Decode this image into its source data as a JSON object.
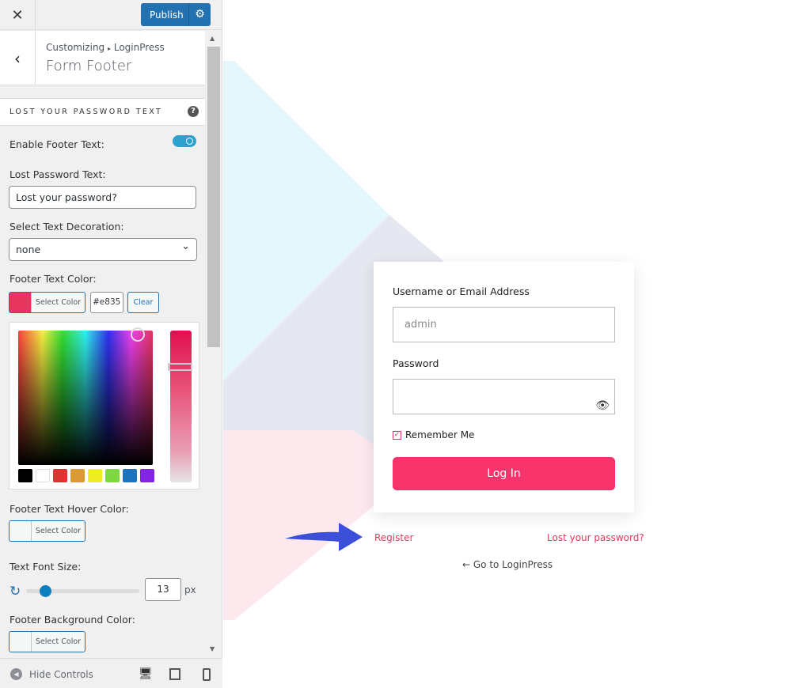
{
  "header": {
    "close_icon": "close-icon",
    "publish_label": "Publish",
    "settings_icon": "gear-icon"
  },
  "panel": {
    "breadcrumb_root": "Customizing",
    "breadcrumb_sep": "▸",
    "breadcrumb_section": "LoginPress",
    "title": "Form Footer",
    "section_title": "LOST YOUR PASSWORD TEXT"
  },
  "controls": {
    "enable_footer_label": "Enable Footer Text:",
    "enable_footer_on": true,
    "lost_password_label": "Lost Password Text:",
    "lost_password_value": "Lost your password?",
    "decoration_label": "Select Text Decoration:",
    "decoration_value": "none",
    "footer_color_label": "Footer Text Color:",
    "select_color": "Select Color",
    "footer_color_hex": "#e835",
    "footer_color": "#e8355f",
    "clear_label": "Clear",
    "palette": [
      "#000000",
      "#ffffff",
      "#dd3333",
      "#dd9933",
      "#eeee22",
      "#81d742",
      "#1e73be",
      "#8224e3"
    ],
    "hover_color_label": "Footer Text Hover Color:",
    "font_size_label": "Text Font Size:",
    "font_size_value": "13",
    "font_size_unit": "px",
    "bg_color_label": "Footer Background Color:"
  },
  "footer": {
    "hide_controls": "Hide Controls"
  },
  "login": {
    "username_label": "Username or Email Address",
    "username_value": "admin",
    "password_label": "Password",
    "remember_label": "Remember Me",
    "login_button": "Log In",
    "register_link": "Register",
    "lost_password_link": "Lost your password?",
    "back_link": "← Go to LoginPress",
    "accent": "#f6346b"
  }
}
